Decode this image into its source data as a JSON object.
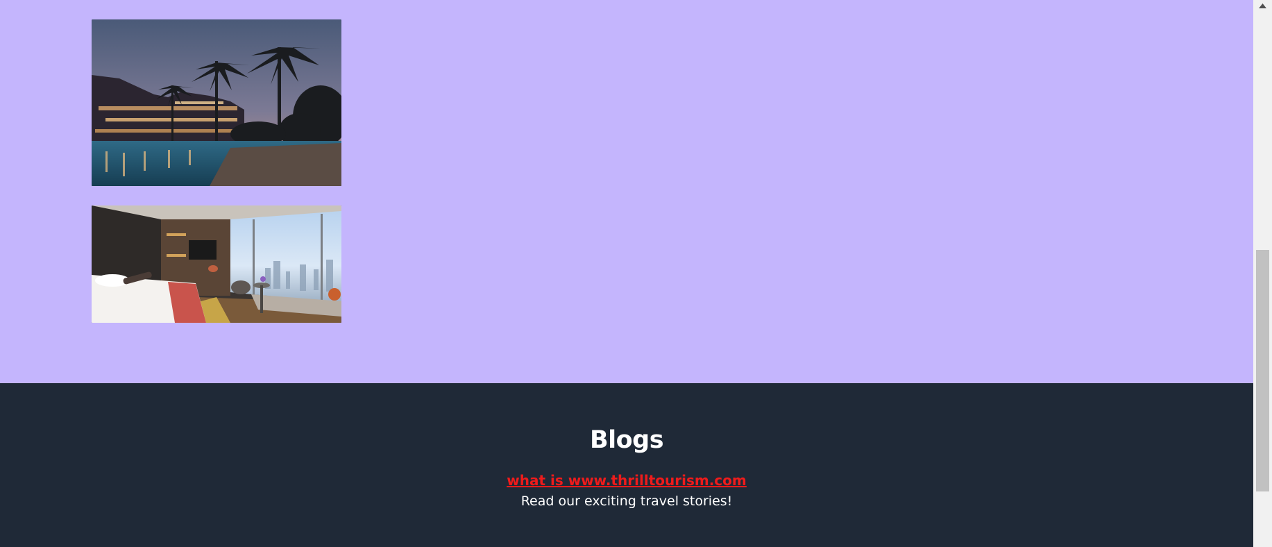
{
  "gallery": {
    "images": [
      {
        "name": "resort-pool-night-image",
        "alt": "Resort with palm trees and pool at dusk"
      },
      {
        "name": "hotel-room-city-view-image",
        "alt": "Hotel room with city view"
      }
    ]
  },
  "footer": {
    "title": "Blogs",
    "link_text": "what is www.thrilltourism.com",
    "tagline": "Read our exciting travel stories!"
  },
  "colors": {
    "page_background": "#c4b5fd",
    "footer_background": "#1f2937",
    "link": "#ef1b1b",
    "text_light": "#ffffff"
  },
  "scrollbar": {
    "up_arrow_icon": "chevron-up-icon"
  }
}
